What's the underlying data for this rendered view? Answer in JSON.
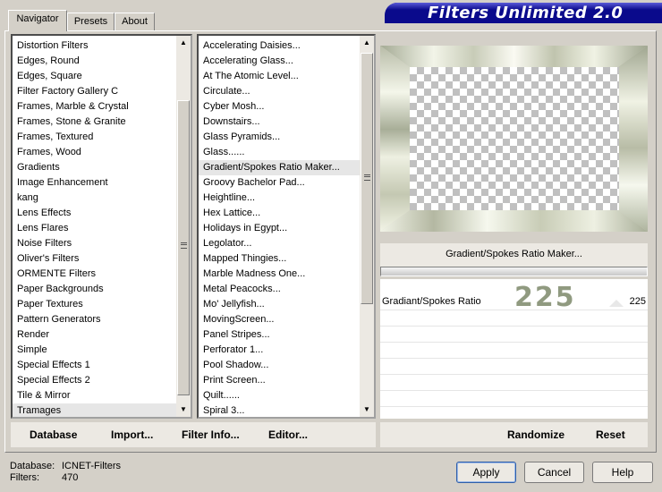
{
  "app": {
    "title": "Filters Unlimited 2.0"
  },
  "tabs": [
    {
      "label": "Navigator"
    },
    {
      "label": "Presets"
    },
    {
      "label": "About"
    }
  ],
  "categories": {
    "items": [
      "Distortion Filters",
      "Edges, Round",
      "Edges, Square",
      "Filter Factory Gallery C",
      "Frames, Marble & Crystal",
      "Frames, Stone & Granite",
      "Frames, Textured",
      "Frames, Wood",
      "Gradients",
      "Image Enhancement",
      "kang",
      "Lens Effects",
      "Lens Flares",
      "Noise Filters",
      "Oliver's Filters",
      "ORMENTE Filters",
      "Paper Backgrounds",
      "Paper Textures",
      "Pattern Generators",
      "Render",
      "Simple",
      "Special Effects 1",
      "Special Effects 2",
      "Tile & Mirror",
      "Tramages"
    ],
    "selected": "Tramages"
  },
  "filters": {
    "items": [
      "Accelerating Daisies...",
      "Accelerating Glass...",
      "At The Atomic Level...",
      "Circulate...",
      "Cyber Mosh...",
      "Downstairs...",
      "Glass Pyramids...",
      "Glass......",
      "Gradient/Spokes Ratio Maker...",
      "Groovy Bachelor Pad...",
      "Heightline...",
      "Hex Lattice...",
      "Holidays in Egypt...",
      "Legolator...",
      "Mapped Thingies...",
      "Marble Madness One...",
      "Metal Peacocks...",
      "Mo' Jellyfish...",
      "MovingScreen...",
      "Panel Stripes...",
      "Perforator 1...",
      "Pool Shadow...",
      "Print Screen...",
      "Quilt......",
      "Spiral 3..."
    ],
    "selected": "Gradient/Spokes Ratio Maker..."
  },
  "preview": {
    "filter_name": "Gradient/Spokes Ratio Maker...",
    "param_label": "Gradiant/Spokes Ratio",
    "param_value": "225",
    "param_big_value": "225"
  },
  "buttons": {
    "database": "Database",
    "import": "Import...",
    "filter_info": "Filter Info...",
    "editor": "Editor...",
    "randomize": "Randomize",
    "reset": "Reset",
    "apply": "Apply",
    "cancel": "Cancel",
    "help": "Help"
  },
  "status": {
    "database_label": "Database:",
    "database_value": "ICNET-Filters",
    "filters_label": "Filters:",
    "filters_value": "470"
  },
  "colors": {
    "banner": "#0a0a8c",
    "frame": "#a8ae98",
    "big_value": "#909a80"
  }
}
